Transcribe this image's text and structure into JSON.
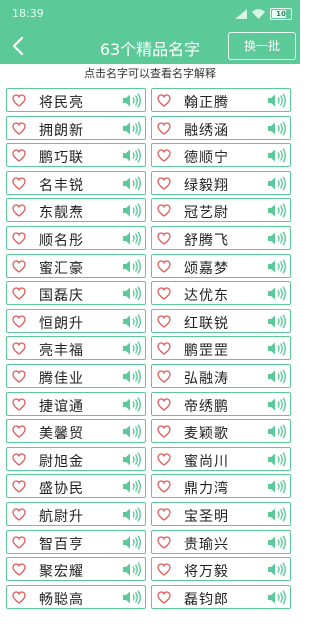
{
  "status": {
    "time": "18:39",
    "battery": "10"
  },
  "header": {
    "title": "63个精品名字",
    "refresh_label": "换一批"
  },
  "hint": "点击名字可以查看名字解释",
  "colors": {
    "accent": "#5cc999",
    "heart": "#e05a5a"
  },
  "names": [
    [
      "将民亮",
      "翰正腾"
    ],
    [
      "拥朗新",
      "融绣涵"
    ],
    [
      "鹏巧联",
      "德顺宁"
    ],
    [
      "名丰锐",
      "绿毅翔"
    ],
    [
      "东靓焘",
      "冠艺尉"
    ],
    [
      "顺名彤",
      "舒腾飞"
    ],
    [
      "蜜汇豪",
      "颂嘉梦"
    ],
    [
      "国磊庆",
      "达优东"
    ],
    [
      "恒朗升",
      "红联锐"
    ],
    [
      "亮丰福",
      "鹏罡罡"
    ],
    [
      "腾佳业",
      "弘融涛"
    ],
    [
      "捷谊通",
      "帝绣鹏"
    ],
    [
      "美馨贸",
      "麦颖歌"
    ],
    [
      "尉旭金",
      "蜜尚川"
    ],
    [
      "盛协民",
      "鼎力湾"
    ],
    [
      "航尉升",
      "宝圣明"
    ],
    [
      "智百亨",
      "贵瑜兴"
    ],
    [
      "聚宏耀",
      "将万毅"
    ],
    [
      "畅聪高",
      "磊钧郎"
    ]
  ]
}
